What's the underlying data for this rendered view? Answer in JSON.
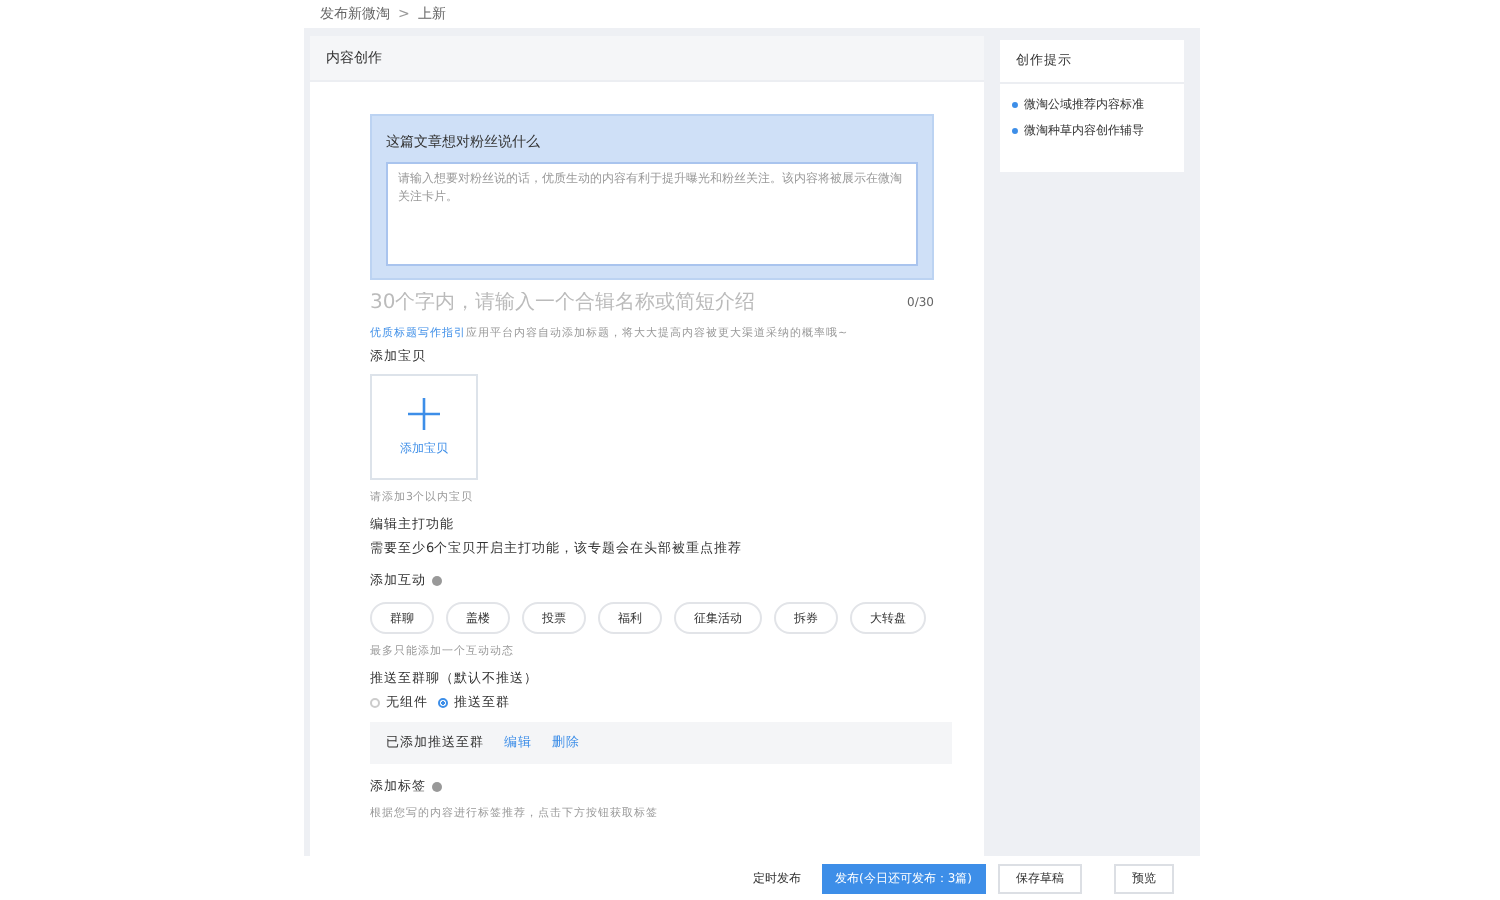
{
  "breadcrumb": {
    "items": [
      "发布新微淘",
      "上新"
    ],
    "separator": ">"
  },
  "card": {
    "title": "内容创作"
  },
  "intro": {
    "label": "这篇文章想对粉丝说什么",
    "placeholder": "请输入想要对粉丝说的话，优质生动的内容有利于提升曝光和粉丝关注。该内容将被展示在微淘关注卡片。"
  },
  "title_field": {
    "placeholder": "30个字内，请输入一个合辑名称或简短介绍",
    "counter": "0/30"
  },
  "guide": {
    "link": "优质标题写作指引",
    "text": "应用平台内容自动添加标题，将大大提高内容被更大渠道采纳的概率哦~"
  },
  "items": {
    "label": "添加宝贝",
    "button": "添加宝贝",
    "hint": "请添加3个以内宝贝"
  },
  "feature": {
    "label": "编辑主打功能",
    "text": "需要至少6个宝贝开启主打功能，该专题会在头部被重点推荐"
  },
  "interaction": {
    "label": "添加互动",
    "chips": [
      "群聊",
      "盖楼",
      "投票",
      "福利",
      "征集活动",
      "拆券",
      "大转盘"
    ],
    "hint": "最多只能添加一个互动动态"
  },
  "push": {
    "label": "推送至群聊（默认不推送）",
    "options": [
      {
        "label": "无组件",
        "selected": false
      },
      {
        "label": "推送至群",
        "selected": true
      }
    ],
    "added": "已添加推送至群",
    "actions": [
      "编辑",
      "删除"
    ]
  },
  "tags": {
    "label": "添加标签",
    "hint": "根据您写的内容进行标签推荐，点击下方按钮获取标签"
  },
  "sidebar": {
    "title": "创作提示",
    "links": [
      "微淘公域推荐内容标准",
      "微淘种草内容创作辅导"
    ]
  },
  "footer": {
    "schedule": "定时发布",
    "publish": "发布(今日还可发布：3篇)",
    "draft": "保存草稿",
    "preview": "预览"
  }
}
